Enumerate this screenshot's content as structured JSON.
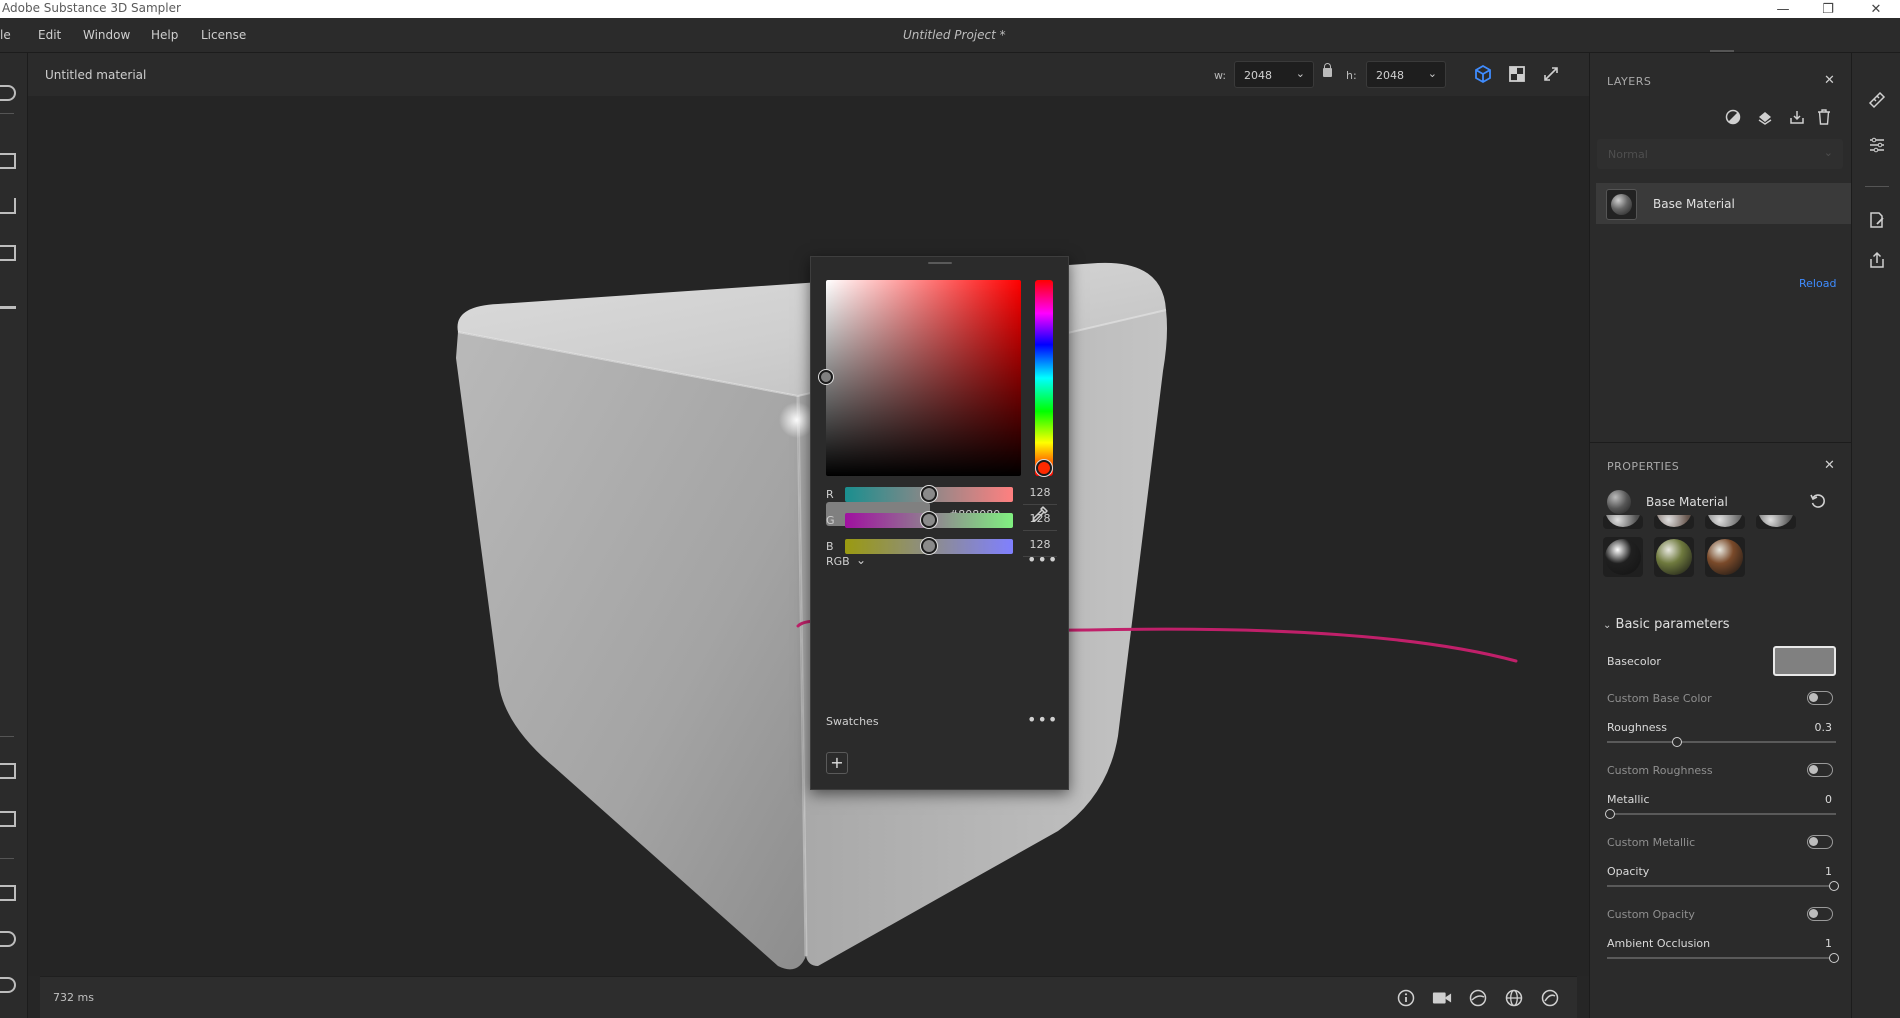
{
  "app": {
    "title": "Adobe Substance 3D Sampler",
    "project_title": "Untitled Project *",
    "window_controls": [
      "minimize-icon",
      "restore-icon",
      "close-icon"
    ]
  },
  "menu": {
    "items": [
      "le",
      "Edit",
      "Window",
      "Help",
      "License"
    ]
  },
  "viewport_header": {
    "material_name": "Untitled material",
    "width_label": "w:",
    "width_value": "2048",
    "height_label": "h:",
    "height_value": "2048",
    "view_buttons": [
      "3d-view-icon",
      "2d-view-icon",
      "fullscreen-icon"
    ]
  },
  "statusbar": {
    "render_time": "732 ms",
    "icons": [
      "info-icon",
      "camera-icon",
      "environment-icon",
      "globe-icon",
      "material-ball-icon"
    ]
  },
  "color_picker": {
    "hex": "#808080",
    "preview_color": "#808080",
    "mode": "RGB",
    "hue_degrees": 10,
    "channels": [
      {
        "label": "R",
        "value": "128",
        "fraction": 0.502,
        "from": "#1a8f8f",
        "to": "#ff8080"
      },
      {
        "label": "G",
        "value": "128",
        "fraction": 0.502,
        "from": "#a010a0",
        "to": "#80f080"
      },
      {
        "label": "B",
        "value": "128",
        "fraction": 0.502,
        "from": "#9a9a10",
        "to": "#8080ff"
      }
    ],
    "swatches_label": "Swatches",
    "add_label": "+"
  },
  "layers": {
    "title": "LAYERS",
    "blend_mode": "Normal",
    "items": [
      {
        "name": "Base Material"
      }
    ],
    "reload_label": "Reload"
  },
  "properties": {
    "title": "PROPERTIES",
    "material_name": "Base Material",
    "presets_row1": [
      "#555555",
      "#6b5a52",
      "#707070",
      "#5a5a5a"
    ],
    "presets_row2": [
      "#202020",
      "#6f7a3e",
      "#7a4a2a"
    ],
    "section": "Basic parameters",
    "basecolor_label": "Basecolor",
    "basecolor_value": "#808080",
    "params": [
      {
        "label": "Custom Base Color",
        "type": "toggle",
        "on": false
      },
      {
        "label": "Roughness",
        "type": "slider",
        "value": "0.3",
        "fraction": 0.3
      },
      {
        "label": "Custom Roughness",
        "type": "toggle",
        "on": false
      },
      {
        "label": "Metallic",
        "type": "slider",
        "value": "0",
        "fraction": 0
      },
      {
        "label": "Custom Metallic",
        "type": "toggle",
        "on": false
      },
      {
        "label": "Opacity",
        "type": "slider",
        "value": "1",
        "fraction": 1
      },
      {
        "label": "Custom Opacity",
        "type": "toggle",
        "on": false
      },
      {
        "label": "Ambient Occlusion",
        "type": "slider",
        "value": "1",
        "fraction": 1
      }
    ]
  },
  "colors": {
    "accent": "#3f8cff",
    "annotation_arrow": "#c0206a"
  }
}
